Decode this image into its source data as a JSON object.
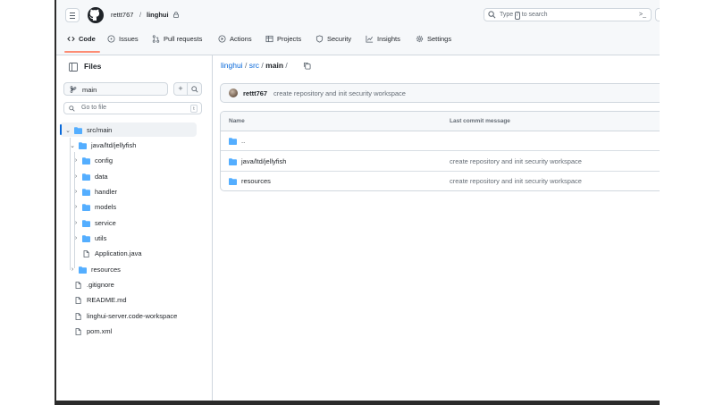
{
  "header": {
    "owner": "rettt767",
    "separator": "/",
    "repo": "linghui",
    "search_text_before": "Type",
    "search_key": "/",
    "search_text_after": "to search",
    "command_icon": "terminal-icon"
  },
  "tabs": [
    {
      "label": "Code",
      "icon": "code-icon",
      "active": true
    },
    {
      "label": "Issues",
      "icon": "issue-opened-icon"
    },
    {
      "label": "Pull requests",
      "icon": "git-pull-request-icon"
    },
    {
      "label": "Actions",
      "icon": "play-icon"
    },
    {
      "label": "Projects",
      "icon": "table-icon"
    },
    {
      "label": "Security",
      "icon": "shield-icon"
    },
    {
      "label": "Insights",
      "icon": "graph-icon"
    },
    {
      "label": "Settings",
      "icon": "gear-icon"
    }
  ],
  "sidebar": {
    "title": "Files",
    "branch": "main",
    "plus_label": "+",
    "goto_placeholder": "Go to file",
    "goto_key": "t",
    "tree": [
      {
        "label": "src/main",
        "type": "folder",
        "open": true,
        "selected": true
      },
      {
        "label": "java/ltd/jellyfish",
        "type": "folder",
        "open": true
      },
      {
        "label": "config",
        "type": "folder"
      },
      {
        "label": "data",
        "type": "folder"
      },
      {
        "label": "handler",
        "type": "folder"
      },
      {
        "label": "models",
        "type": "folder"
      },
      {
        "label": "service",
        "type": "folder"
      },
      {
        "label": "utils",
        "type": "folder"
      },
      {
        "label": "Application.java",
        "type": "file"
      },
      {
        "label": "resources",
        "type": "folder"
      },
      {
        "label": ".gitignore",
        "type": "file"
      },
      {
        "label": "README.md",
        "type": "file"
      },
      {
        "label": "linghui-server.code-workspace",
        "type": "file"
      },
      {
        "label": "pom.xml",
        "type": "file"
      }
    ]
  },
  "main": {
    "path": [
      "linghui",
      "src",
      "main"
    ],
    "path_sep": "/",
    "commit": {
      "author": "rettt767",
      "message": "create repository and init security workspace"
    },
    "columns": [
      "Name",
      "Last commit message"
    ],
    "rows": [
      {
        "name": "..",
        "message": ""
      },
      {
        "name": "java/ltd/jellyfish",
        "message": "create repository and init security workspace"
      },
      {
        "name": "resources",
        "message": "create repository and init security workspace"
      }
    ]
  },
  "colors": {
    "accent": "#0969da",
    "folder": "#54aeff",
    "tab_underline": "#fd8c73",
    "border": "#d0d7de"
  }
}
